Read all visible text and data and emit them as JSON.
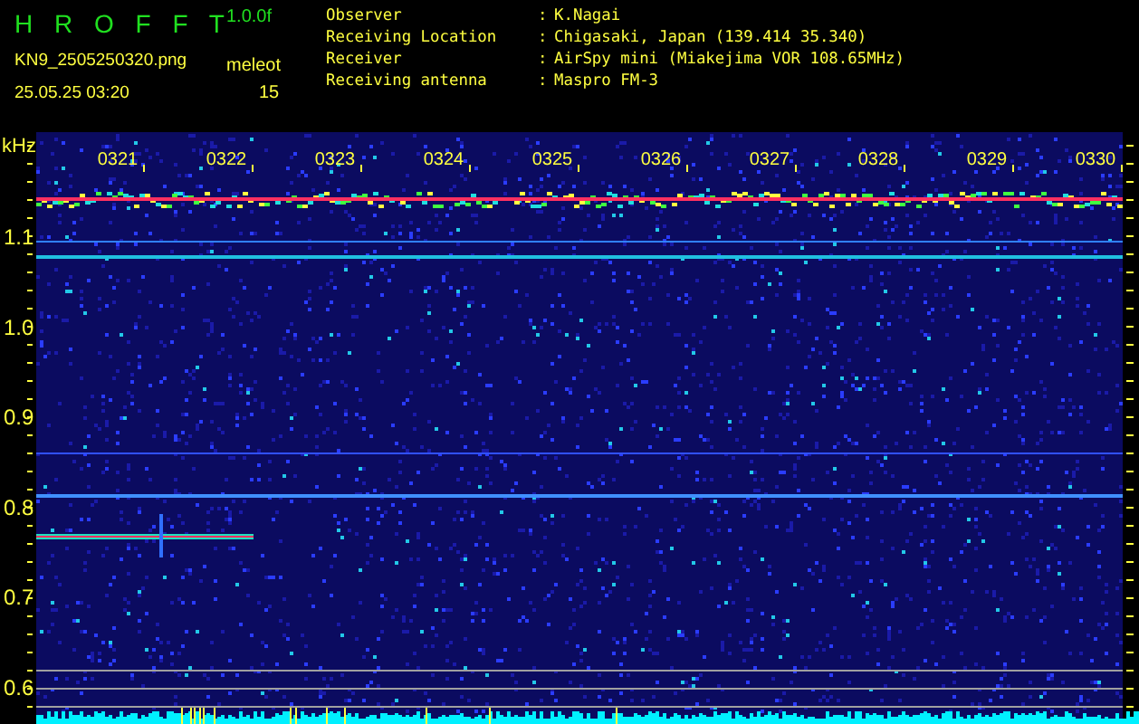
{
  "app": {
    "title": "H R O F F T",
    "version": "1.0.0f"
  },
  "file": {
    "name": "KN9_2505250320.png",
    "datetime": "25.05.25 03:20"
  },
  "meteor": {
    "label": "meleot",
    "count": "15"
  },
  "info_separator": ":",
  "info": [
    {
      "label": "Observer",
      "value": "K.Nagai"
    },
    {
      "label": "Receiving Location",
      "value": "Chigasaki, Japan (139.414 35.340)"
    },
    {
      "label": "Receiver",
      "value": "AirSpy mini (Miakejima VOR 108.65MHz)"
    },
    {
      "label": "Receiving antenna",
      "value": "Maspro FM-3"
    }
  ],
  "spectrogram": {
    "unit": "kHz",
    "y_labels": [
      "1.1",
      "1.0",
      "0.9",
      "0.8",
      "0.7",
      "0.6"
    ],
    "time_labels": [
      "0321",
      "0322",
      "0323",
      "0324",
      "0325",
      "0326",
      "0327",
      "0328",
      "0329",
      "0330"
    ]
  }
}
